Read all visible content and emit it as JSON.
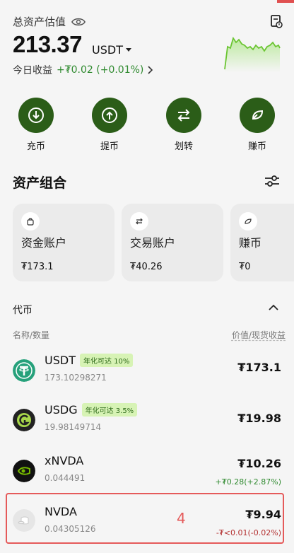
{
  "header": {
    "total_label": "总资产估值",
    "amount": "213.37",
    "currency": "USDT",
    "today_label": "今日收益",
    "today_pnl": "+₮0.02 (+0.01%)"
  },
  "actions": [
    {
      "label": "充币"
    },
    {
      "label": "提币"
    },
    {
      "label": "划转"
    },
    {
      "label": "赚币"
    }
  ],
  "portfolio": {
    "title": "资产组合",
    "cards": [
      {
        "title": "资金账户",
        "value": "₮173.1"
      },
      {
        "title": "交易账户",
        "value": "₮40.26"
      },
      {
        "title": "赚币",
        "value": "₮0"
      }
    ]
  },
  "tokens": {
    "title": "代币",
    "col_left": "名称/数量",
    "col_right": "价值/现货收益",
    "items": [
      {
        "name": "USDT",
        "badge": "年化可达 10%",
        "qty": "173.10298271",
        "value": "₮173.1",
        "change": ""
      },
      {
        "name": "USDG",
        "badge": "年化可达 3.5%",
        "qty": "19.98149714",
        "value": "₮19.98",
        "change": ""
      },
      {
        "name": "xNVDA",
        "badge": "",
        "qty": "0.044491",
        "value": "₮10.26",
        "change": "+₮0.28(+2.87%)"
      },
      {
        "name": "NVDA",
        "badge": "",
        "qty": "0.04305126",
        "value": "₮9.94",
        "change": "-₮<0.01(-0.02%)"
      }
    ]
  },
  "annotation": {
    "label": "4"
  },
  "colors": {
    "accent": "#2b5d18",
    "positive": "#2f8a2f",
    "negative": "#b33030",
    "highlight": "#e55a5a"
  }
}
